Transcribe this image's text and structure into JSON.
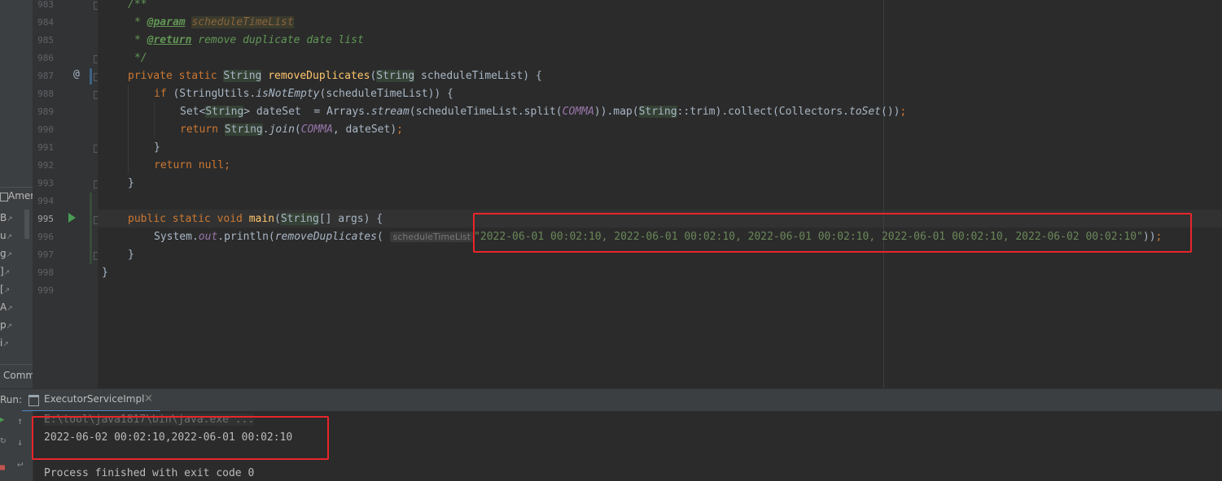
{
  "left_panel": {
    "items": [
      "B",
      "u",
      "g",
      "]",
      "[",
      "A",
      "p",
      "i"
    ],
    "header_label": "Amer",
    "comm_label": "Comm",
    "pencil_glyph": "↗"
  },
  "gutter": {
    "line_numbers": [
      "983",
      "984",
      "985",
      "986",
      "987",
      "988",
      "989",
      "990",
      "991",
      "992",
      "993",
      "994",
      "995",
      "996",
      "997",
      "998",
      "999"
    ],
    "override_marker": "@"
  },
  "code": {
    "l983": {
      "doc": "/**"
    },
    "l984": {
      "star": "* ",
      "tag": "@param",
      "param": "scheduleTimeList"
    },
    "l985": {
      "star": "* ",
      "tag": "@return",
      "text": " remove duplicate date list"
    },
    "l986": {
      "doc": "*/"
    },
    "l987": {
      "kw1": "private static ",
      "type1": "String",
      "fn": "removeDuplicates",
      "p1": "(",
      "type2": "String",
      "rest": " scheduleTimeList) {"
    },
    "l988": {
      "kw": "if ",
      "a": "(StringUtils.",
      "m": "isNotEmpty",
      "b": "(scheduleTimeList)) {"
    },
    "l989": {
      "a": "Set<",
      "t": "String",
      "b": "> dateSet  = Arrays.",
      "m": "stream",
      "c": "(scheduleTimeList.split(",
      "k": "COMMA",
      "d": ")).map(",
      "t2": "String",
      "e": "::trim).collect(Collectors.",
      "m2": "toSet",
      "f": "())",
      "semi": ";"
    },
    "l990": {
      "kw": "return ",
      "t": "String",
      "a": ".",
      "m": "join",
      "b": "(",
      "k": "COMMA",
      "c": ", dateSet)",
      "semi": ";"
    },
    "l991": {
      "a": "}"
    },
    "l992": {
      "kw": "return null",
      "semi": ";"
    },
    "l993": {
      "a": "}"
    },
    "l995": {
      "kw": "public static void ",
      "fn": "main",
      "a": "(",
      "t": "String",
      "b": "[] args) {"
    },
    "l996": {
      "a": "System.",
      "out": "out",
      "b": ".println(",
      "m": "removeDuplicates",
      "c": "( ",
      "hint": "scheduleTimeList",
      "str": "\"2022-06-01 00:02:10, 2022-06-01 00:02:10, 2022-06-01 00:02:10, 2022-06-01 00:02:10, 2022-06-02 00:02:10\"",
      "d": "))",
      "semi": ";"
    },
    "l997": {
      "a": "}"
    },
    "l998": {
      "a": "}"
    }
  },
  "run": {
    "label": "Run:",
    "tab_label": "ExecutorServiceImpl",
    "close_glyph": "×",
    "side_icons": [
      "▶",
      "↑",
      "↻",
      "↓",
      "↵",
      "■"
    ],
    "console": {
      "cmd": "E:\\tool\\java1817\\bin\\java.exe ...",
      "output": "2022-06-02 00:02:10,2022-06-01 00:02:10",
      "exit": "Process finished with exit code 0"
    }
  },
  "colors": {
    "editor_bg": "#2b2b2b",
    "gutter_bg": "#313335",
    "keyword": "#cc7832",
    "string": "#6a8759",
    "function": "#ffc66d",
    "constant": "#9876aa",
    "doc_comment": "#629755",
    "highlight_box": "#e8262a",
    "tab_underline": "#4a88c7"
  }
}
